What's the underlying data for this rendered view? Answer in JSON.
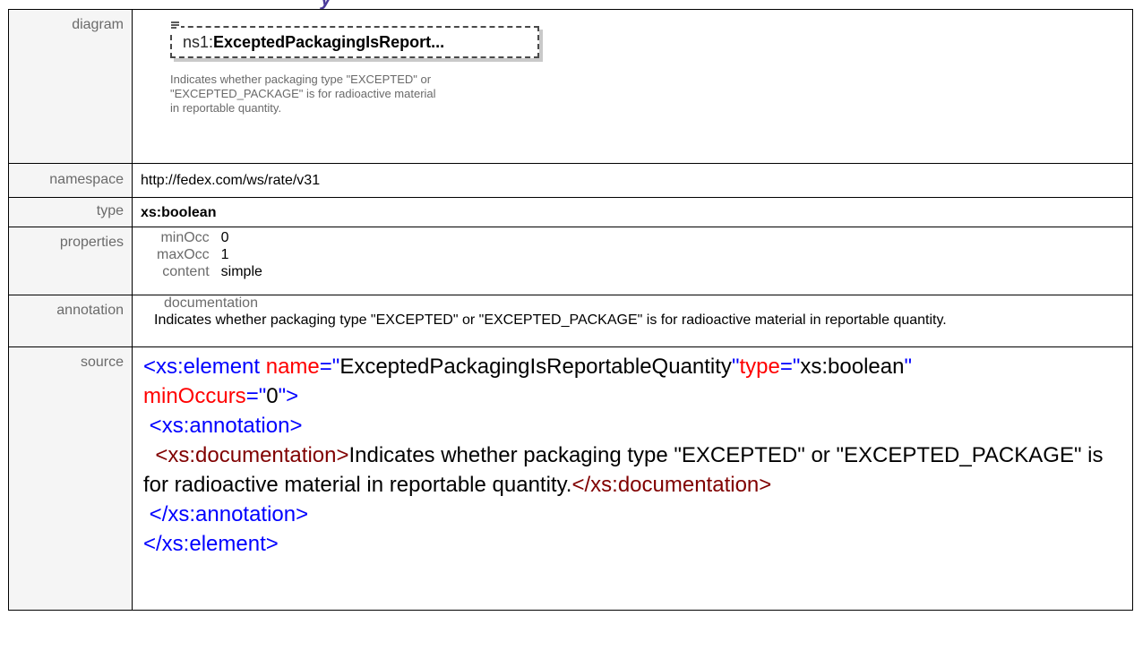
{
  "rows": {
    "diagram": {
      "label": "diagram",
      "element": {
        "prefix": "ns1:",
        "name": "ExceptedPackagingIsReport...",
        "icon": "documentation-icon",
        "note": "Indicates whether packaging type \"EXCEPTED\" or \"EXCEPTED_PACKAGE\" is for radioactive material in reportable quantity."
      }
    },
    "namespace": {
      "label": "namespace",
      "value": "http://fedex.com/ws/rate/v31"
    },
    "type": {
      "label": "type",
      "value": "xs:boolean"
    },
    "properties": {
      "label": "properties",
      "items": [
        {
          "key": "minOcc",
          "value": "0"
        },
        {
          "key": "maxOcc",
          "value": "1"
        },
        {
          "key": "content",
          "value": "simple"
        }
      ]
    },
    "annotation": {
      "label": "annotation",
      "heading": "documentation",
      "text": "Indicates whether packaging type \"EXCEPTED\" or \"EXCEPTED_PACKAGE\" is for radioactive material in reportable quantity."
    },
    "source": {
      "label": "source",
      "lines": {
        "l1_open": "<xs:element ",
        "l1_attr1": "name",
        "l1_eq1": "=\"",
        "l1_val1": "ExceptedPackagingIsReportableQuantity",
        "l1_q1": "\"",
        "l1_attr2": "type",
        "l1_eq2": "=\"",
        "l1_val2": "xs:boolean",
        "l1_q2": "\"",
        "l2_attr3": "minOccurs",
        "l2_eq3": "=\"",
        "l2_val3": "0",
        "l2_close": "\">",
        "l3": "<xs:annotation>",
        "l4_open": "<xs:documentation>",
        "l4_text": "Indicates whether packaging type \"EXCEPTED\" or \"EXCEPTED_PACKAGE\" is for radioactive material in reportable quantity.",
        "l4_close": "</xs:documentation>",
        "l5": "</xs:annotation>",
        "l6": "</xs:element>"
      }
    }
  },
  "colors": {
    "tag": "#0000ff",
    "doc_tag": "#800000",
    "attr_name": "#ff0000",
    "heading_fragment": "#4b3a9a"
  }
}
